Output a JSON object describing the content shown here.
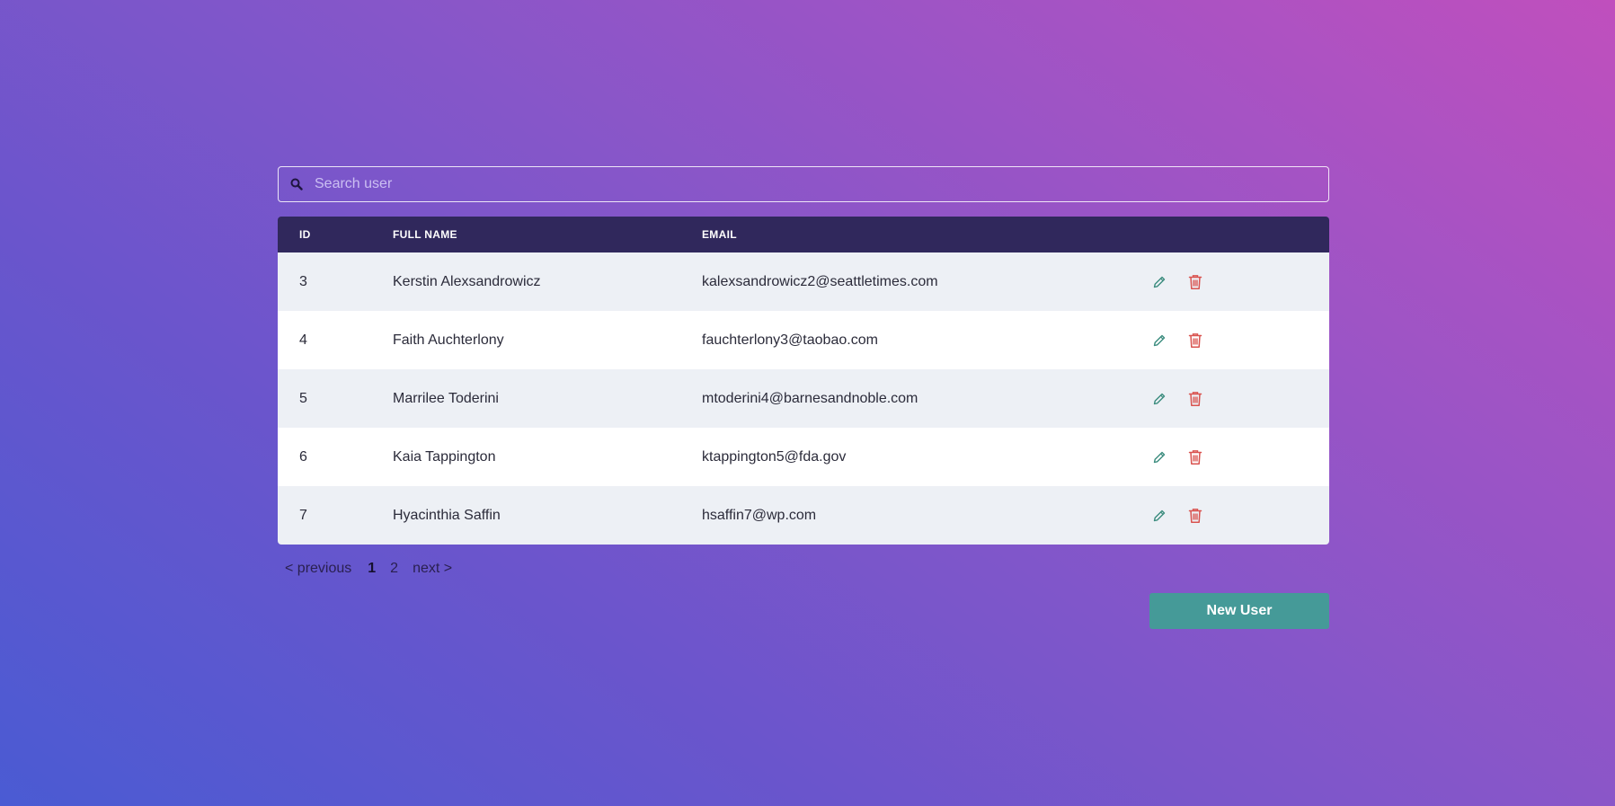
{
  "search": {
    "placeholder": "Search user",
    "value": "",
    "icon": "search-icon"
  },
  "table": {
    "columns": [
      "ID",
      "FULL NAME",
      "EMAIL"
    ],
    "rows": [
      {
        "id": "3",
        "name": "Kerstin Alexsandrowicz",
        "email": "kalexsandrowicz2@seattletimes.com"
      },
      {
        "id": "4",
        "name": "Faith Auchterlony",
        "email": "fauchterlony3@taobao.com"
      },
      {
        "id": "5",
        "name": "Marrilee Toderini",
        "email": "mtoderini4@barnesandnoble.com"
      },
      {
        "id": "6",
        "name": "Kaia Tappington",
        "email": "ktappington5@fda.gov"
      },
      {
        "id": "7",
        "name": "Hyacinthia Saffin",
        "email": "hsaffin7@wp.com"
      }
    ],
    "actions": {
      "edit_icon": "pencil-icon",
      "delete_icon": "trash-icon"
    }
  },
  "pagination": {
    "previous": "< previous",
    "pages": [
      "1",
      "2"
    ],
    "current": "1",
    "next": "next >"
  },
  "new_user_button": "New User",
  "colors": {
    "header_bg": "#30285c",
    "row_odd": "#edf0f5",
    "row_even": "#ffffff",
    "edit_icon": "#3b8c7e",
    "delete_icon": "#d9534f",
    "button_bg": "#459a98"
  }
}
